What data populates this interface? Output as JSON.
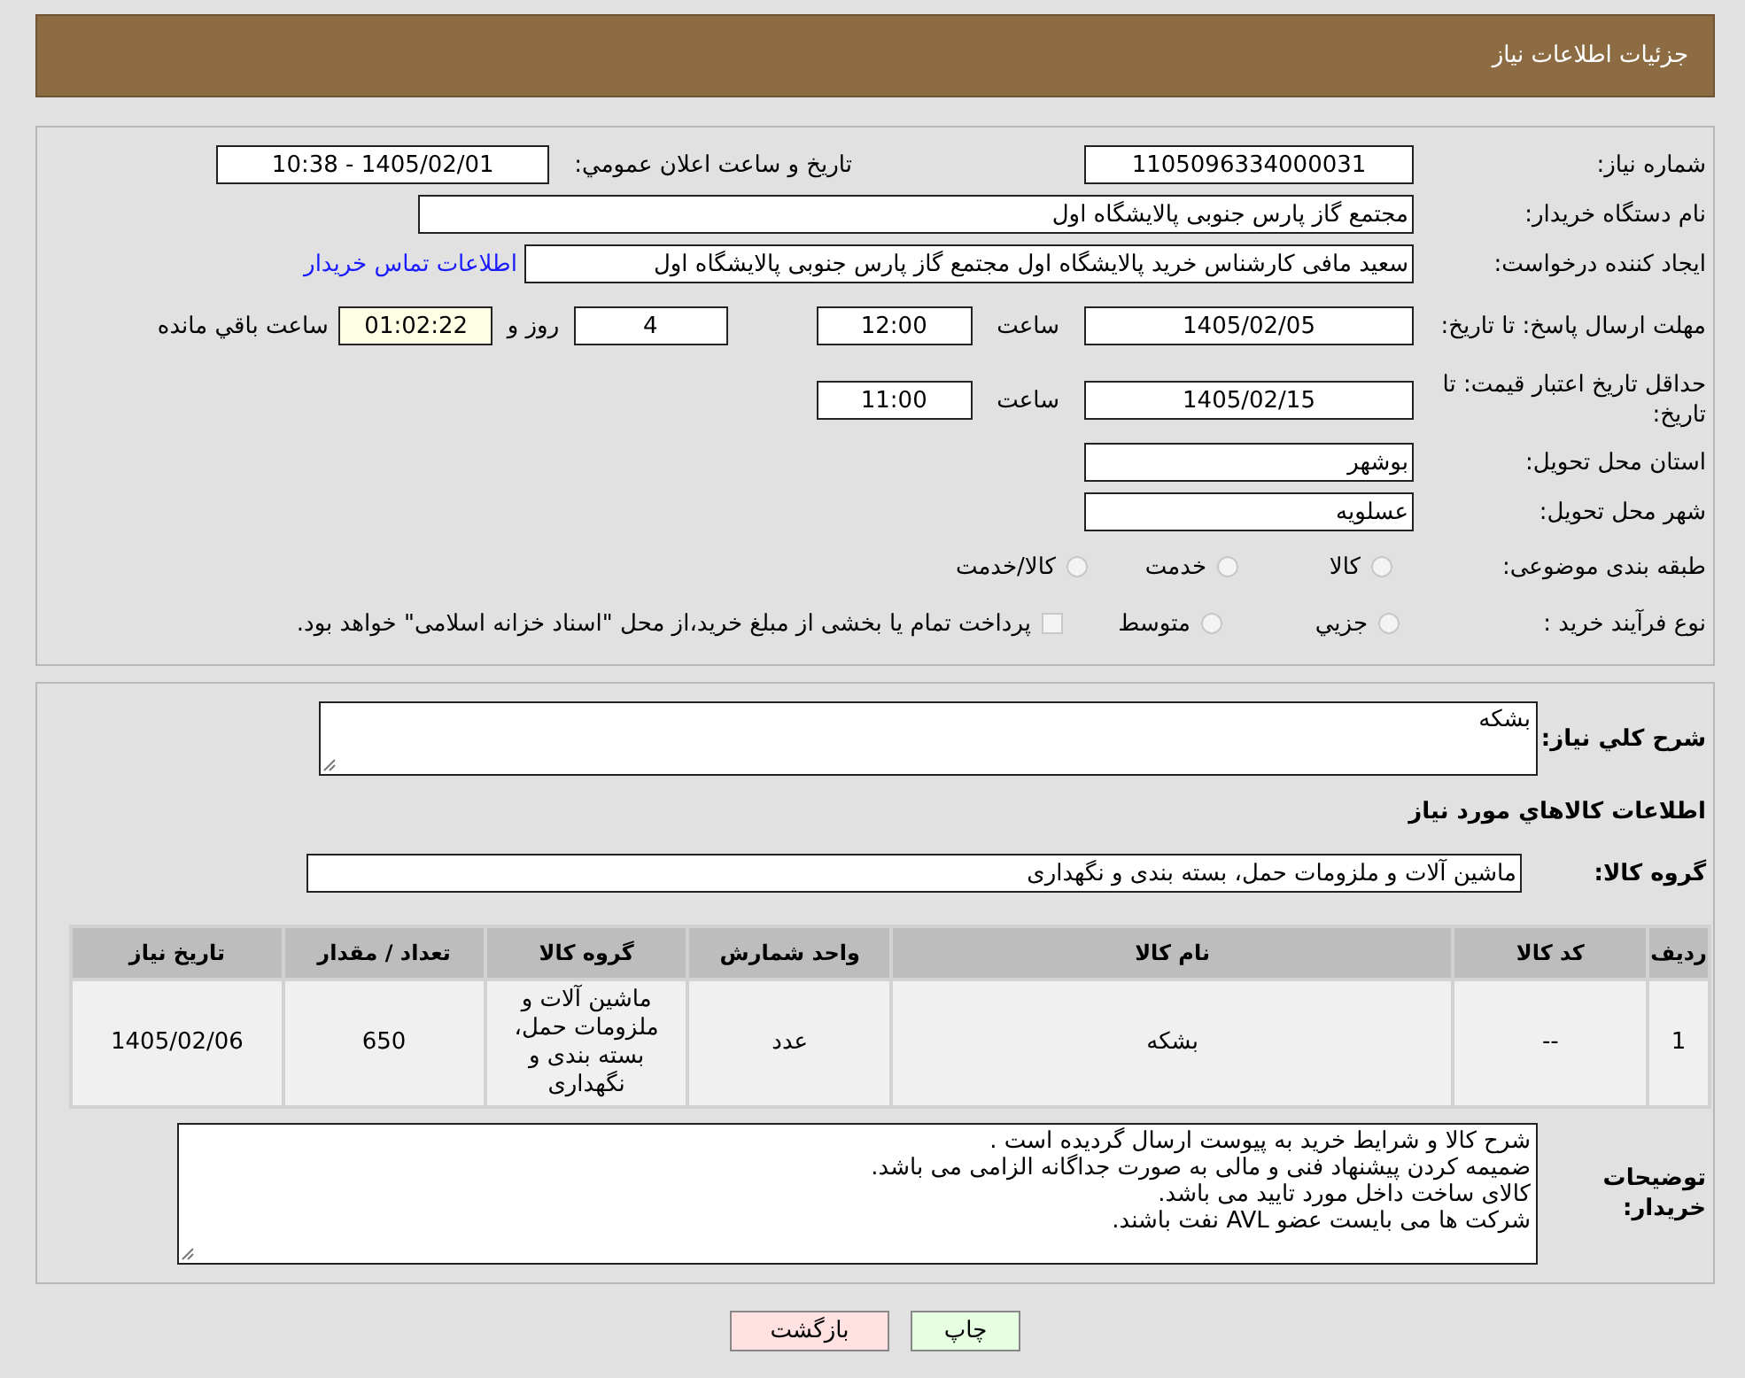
{
  "header": {
    "title": "جزئیات اطلاعات نیاز"
  },
  "need_number": {
    "label": "شماره نیاز:",
    "value": "1105096334000031"
  },
  "announce": {
    "label": "تاریخ و ساعت اعلان عمومي:",
    "value": "1405/02/01 - 10:38"
  },
  "buyer_org": {
    "label": "نام دستگاه خریدار:",
    "value": "مجتمع گاز پارس جنوبی  پالایشگاه اول"
  },
  "requester": {
    "label": "ایجاد کننده درخواست:",
    "value": "سعید مافی کارشناس خرید پالایشگاه اول مجتمع گاز پارس جنوبی  پالایشگاه اول",
    "link": "اطلاعات تماس خریدار"
  },
  "reply_deadline": {
    "label": "مهلت ارسال پاسخ: تا تاریخ:",
    "date": "1405/02/05",
    "time_label": "ساعت",
    "time": "12:00",
    "days": "4",
    "days_label": "روز و",
    "remaining": "01:02:22",
    "remaining_label": "ساعت باقي مانده"
  },
  "price_validity": {
    "label": "حداقل تاریخ اعتبار قیمت: تا تاریخ:",
    "date": "1405/02/15",
    "time_label": "ساعت",
    "time": "11:00"
  },
  "province": {
    "label": "استان محل تحویل:",
    "value": "بوشهر"
  },
  "city": {
    "label": "شهر محل تحویل:",
    "value": "عسلویه"
  },
  "category": {
    "label": "طبقه بندی موضوعی:",
    "options": [
      {
        "label": "کالا",
        "selected": false
      },
      {
        "label": "خدمت",
        "selected": false
      },
      {
        "label": "کالا/خدمت",
        "selected": false
      }
    ]
  },
  "purchase_type": {
    "label": "نوع فرآیند خرید :",
    "options": [
      {
        "kind": "radio",
        "label": "جزيي",
        "selected": false
      },
      {
        "kind": "radio",
        "label": "متوسط",
        "selected": false
      },
      {
        "kind": "checkbox",
        "label": "پرداخت تمام یا بخشی از مبلغ خرید،از محل \"اسناد خزانه اسلامی\" خواهد بود.",
        "checked": false
      }
    ]
  },
  "description": {
    "label": "شرح کلي نیاز:",
    "value": "بشکه"
  },
  "goods_title": "اطلاعات کالاهاي مورد نیاز",
  "goods_group": {
    "label": "گروه کالا:",
    "value": "ماشین آلات و ملزومات حمل، بسته بندی و نگهداری"
  },
  "table": {
    "columns": [
      "ردیف",
      "کد کالا",
      "نام کالا",
      "واحد شمارش",
      "گروه کالا",
      "تعداد / مقدار",
      "تاریخ نیاز"
    ],
    "rows": [
      [
        "1",
        "--",
        "بشکه",
        "عدد",
        "ماشین آلات و ملزومات حمل، بسته بندی و نگهداری",
        "650",
        "1405/02/06"
      ]
    ]
  },
  "buyer_notes": {
    "label": "توضیحات خریدار:",
    "lines": [
      "شرح کالا و شرایط خرید به پیوست ارسال گردیده است .",
      "ضمیمه کردن پیشنهاد فنی و مالی به صورت جداگانه الزامی می باشد.",
      "کالای ساخت داخل مورد تایید می باشد.",
      "شرکت ها می بایست عضو AVL نفت باشند."
    ]
  },
  "buttons": [
    {
      "kind": "print",
      "label": "چاپ"
    },
    {
      "kind": "back",
      "label": "بازگشت"
    }
  ]
}
